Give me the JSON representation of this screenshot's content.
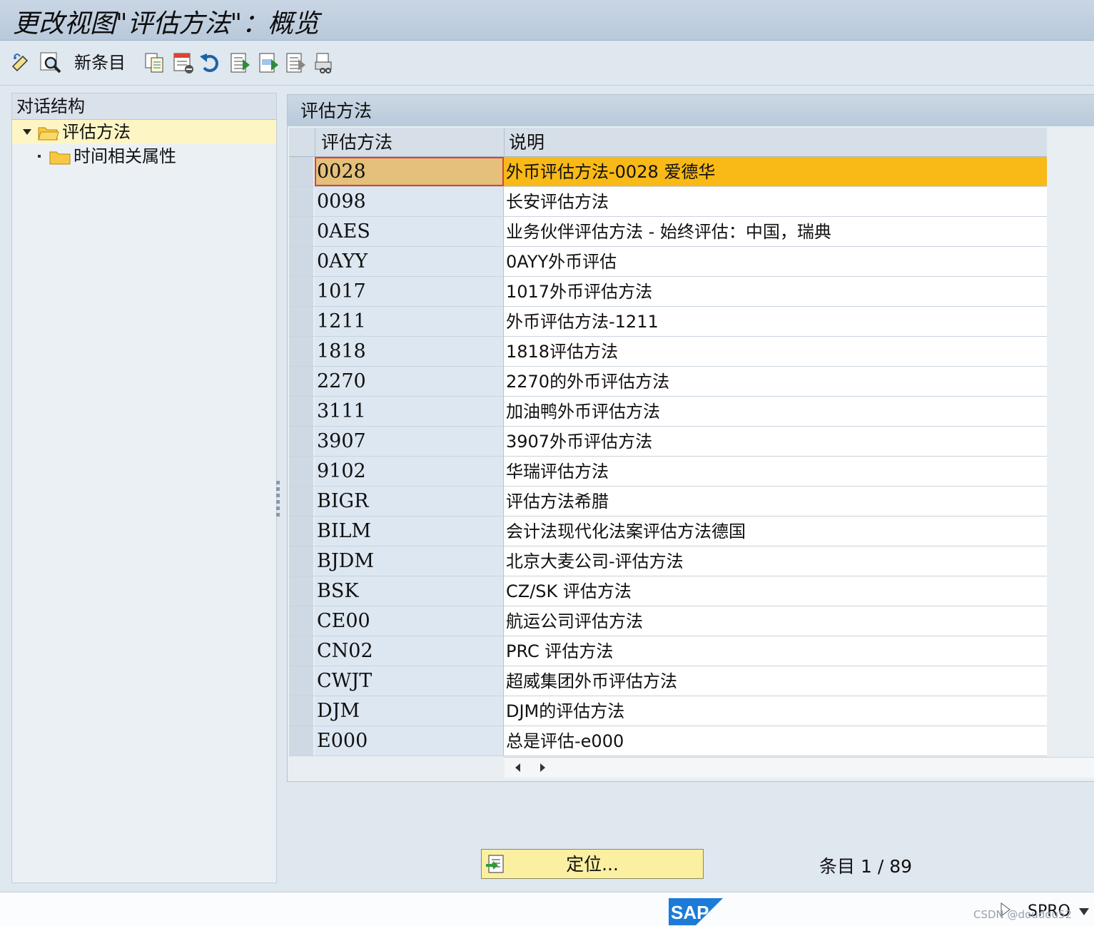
{
  "window": {
    "title": "更改视图\"评估方法\"：概览"
  },
  "toolbar": {
    "new_entry_label": "新条目",
    "icons": [
      "display-change-icon",
      "find-icon",
      "copy-as-icon",
      "delete-icon",
      "undo-icon",
      "select-all-icon",
      "select-block-icon",
      "deselect-all-icon",
      "print-icon"
    ]
  },
  "left_panel": {
    "header": "对话结构",
    "tree": [
      {
        "label": "评估方法",
        "expanded": true,
        "selected": true
      },
      {
        "label": "时间相关属性",
        "expanded": false,
        "selected": false
      }
    ]
  },
  "right_panel": {
    "header": "评估方法",
    "columns": [
      "评估方法",
      "说明"
    ],
    "rows": [
      {
        "code": "0028",
        "desc": "外币评估方法-0028 爱德华",
        "active": true
      },
      {
        "code": "0098",
        "desc": "长安评估方法"
      },
      {
        "code": "0AES",
        "desc": "业务伙伴评估方法 - 始终评估：中国，瑞典"
      },
      {
        "code": "0AYY",
        "desc": "0AYY外币评估"
      },
      {
        "code": "1017",
        "desc": "1017外币评估方法"
      },
      {
        "code": "1211",
        "desc": "外币评估方法-1211"
      },
      {
        "code": "1818",
        "desc": "1818评估方法"
      },
      {
        "code": "2270",
        "desc": "2270的外币评估方法"
      },
      {
        "code": "3111",
        "desc": "加油鸭外币评估方法"
      },
      {
        "code": "3907",
        "desc": "3907外币评估方法"
      },
      {
        "code": "9102",
        "desc": "华瑞评估方法"
      },
      {
        "code": "BIGR",
        "desc": "评估方法希腊"
      },
      {
        "code": "BILM",
        "desc": "会计法现代化法案评估方法德国"
      },
      {
        "code": "BJDM",
        "desc": "北京大麦公司-评估方法"
      },
      {
        "code": "BSK",
        "desc": "CZ/SK 评估方法"
      },
      {
        "code": "CE00",
        "desc": "航运公司评估方法"
      },
      {
        "code": "CN02",
        "desc": "PRC 评估方法"
      },
      {
        "code": "CWJT",
        "desc": "超威集团外币评估方法"
      },
      {
        "code": "DJM",
        "desc": "DJM的评估方法"
      },
      {
        "code": "E000",
        "desc": "总是评估-e000"
      }
    ]
  },
  "footer": {
    "locate_button": "定位...",
    "entries_label": "条目",
    "entries_value": "1 / 89"
  },
  "status_bar": {
    "logo": "SAP",
    "tcode": "SPRO",
    "watermark": "CSDN @doudou52"
  },
  "colors": {
    "active_row": "#f9b917",
    "active_key": "#e4c07a",
    "tree_selected": "#fdf5c4",
    "locate_button": "#fbf0a2"
  }
}
